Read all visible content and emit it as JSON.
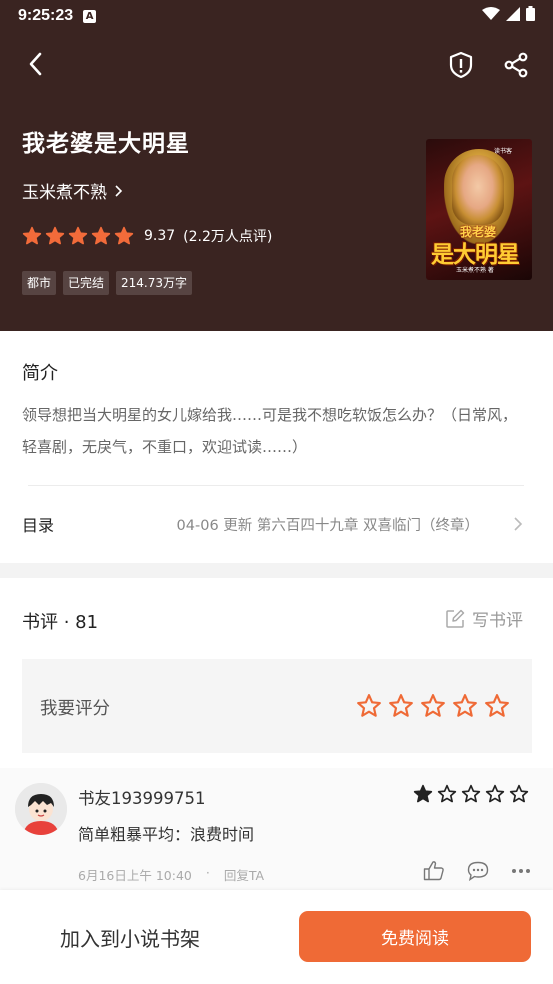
{
  "status_bar": {
    "time": "9:25:23",
    "notification_icon": "A"
  },
  "header": {
    "back_icon": "chevron-left-icon",
    "report_icon": "shield-alert-icon",
    "share_icon": "share-icon",
    "background_color": "#3a2421"
  },
  "book": {
    "title": "我老婆是大明星",
    "author": "玉米煮不熟",
    "rating_stars": 5,
    "score": "9.37",
    "rating_count": "(2.2万人点评)",
    "tags": [
      "都市",
      "已完结",
      "214.73万字"
    ],
    "cover": {
      "publisher": "读书客",
      "title_small": "我老婆",
      "title_large": "是大明星",
      "author_text": "玉米煮不熟 著"
    }
  },
  "intro": {
    "title": "简介",
    "text": "领导想把当大明星的女儿嫁给我……可是我不想吃软饭怎么办？（日常风，轻喜剧，无戾气，不重口，欢迎试读……）"
  },
  "toc": {
    "label": "目录",
    "latest": "04-06  更新  第六百四十九章 双喜临门（终章）"
  },
  "reviews": {
    "title": "书评 · 81",
    "write_label": "写书评",
    "rate_prompt": "我要评分",
    "accent_color": "#ef6a36",
    "items": [
      {
        "user": "书友193999751",
        "stars": 1,
        "text": "简单粗暴平均：浪费时间",
        "time": "6月16日上午 10:40",
        "separator": "·",
        "reply_label": "回复TA"
      }
    ]
  },
  "bottom": {
    "add_shelf_label": "加入到小说书架",
    "read_label": "免费阅读"
  }
}
